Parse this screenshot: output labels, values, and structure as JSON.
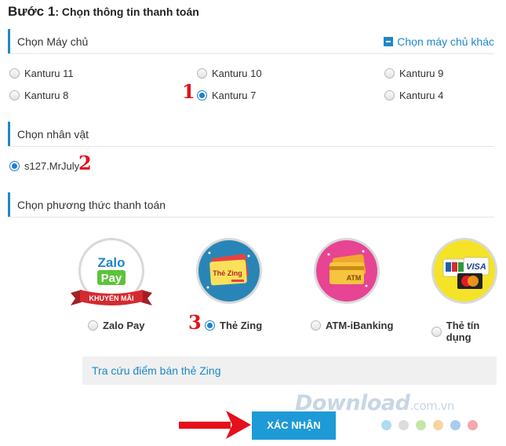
{
  "step": {
    "prefix": "Bước 1",
    "title": ": Chọn thông tin thanh toán"
  },
  "server_section": {
    "label": "Chọn Máy chủ",
    "other_link": "Chọn máy chủ khác",
    "servers": [
      {
        "label": "Kanturu 11",
        "selected": false
      },
      {
        "label": "Kanturu 10",
        "selected": false
      },
      {
        "label": "Kanturu 9",
        "selected": false
      },
      {
        "label": "Kanturu 8",
        "selected": false
      },
      {
        "label": "Kanturu 7",
        "selected": true
      },
      {
        "label": "Kanturu 4",
        "selected": false
      }
    ]
  },
  "character_section": {
    "label": "Chọn nhân vật",
    "characters": [
      {
        "label": "s127.MrJuly",
        "selected": true
      }
    ]
  },
  "payment_section": {
    "label": "Chọn phương thức thanh toán",
    "methods": [
      {
        "label": "Zalo Pay",
        "selected": false,
        "icon": "zalopay-logo-icon",
        "logo_line1": "Zalo",
        "logo_line2": "Pay",
        "ribbon": "KHUYẾN MÃI"
      },
      {
        "label": "Thẻ Zing",
        "selected": true,
        "icon": "zing-card-icon",
        "card_text": "Thẻ Zing"
      },
      {
        "label": "ATM-iBanking",
        "selected": false,
        "icon": "atm-card-icon",
        "card_text": "ATM"
      },
      {
        "label": "Thẻ tín dụng",
        "selected": false,
        "icon": "credit-card-icon",
        "card_text": "VISA"
      }
    ]
  },
  "lookup_link": "Tra cứu điểm bán thẻ Zing",
  "confirm_button": "XÁC NHẬN",
  "markers": [
    "1",
    "2",
    "3"
  ],
  "watermark": {
    "main": "Download",
    "suffix": ".com.vn"
  },
  "watermark_dots": [
    "#aedbf5",
    "#dcdcdc",
    "#c6e6a8",
    "#f8d3a4",
    "#a8cdef",
    "#f3a9ad"
  ],
  "colors": {
    "accent": "#1e88c8",
    "button": "#1e9ad6",
    "marker": "#e5101b",
    "arrow": "#e5101b"
  }
}
